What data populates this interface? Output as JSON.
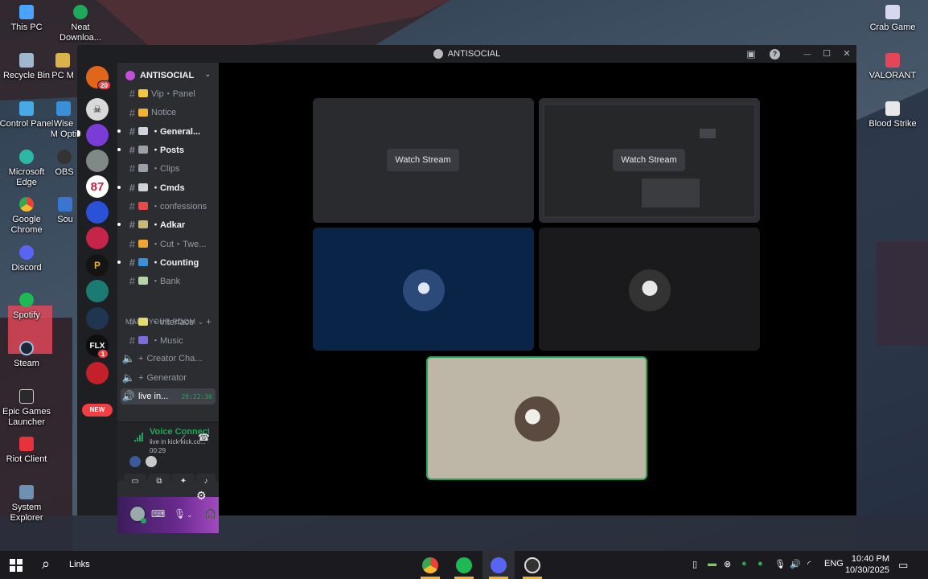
{
  "desktop": {
    "icons_left": [
      {
        "label": "This PC",
        "color": "#4aa3ff"
      },
      {
        "label": "Recycle Bin",
        "color": "#9fb7cf"
      },
      {
        "label": "Control Panel",
        "color": "#47a9e6"
      },
      {
        "label": "Microsoft Edge",
        "color": "#2fb7a6"
      },
      {
        "label": "Google Chrome",
        "color": "#e2b03a"
      },
      {
        "label": "Discord",
        "color": "#5865f2"
      },
      {
        "label": "Spotify",
        "color": "#1db954"
      },
      {
        "label": "Steam",
        "color": "#1b2838"
      },
      {
        "label": "Epic Games Launcher",
        "color": "#2a2a2a"
      },
      {
        "label": "Riot Client",
        "color": "#e6333b"
      },
      {
        "label": "System Explorer",
        "color": "#6f8fb3"
      }
    ],
    "icons_col2": [
      {
        "label": "Neat Downloa...",
        "color": "#1ea85c"
      },
      {
        "label": "PC M",
        "color": "#d9b24a"
      },
      {
        "label": "Wise M Opti",
        "color": "#3a8fd9"
      },
      {
        "label": "OBS",
        "color": "#333"
      },
      {
        "label": "Sou",
        "color": "#3a76d0"
      }
    ],
    "icons_right": [
      {
        "label": "Crab Game",
        "color": "#d7d7f0"
      },
      {
        "label": "VALORANT",
        "color": "#e34658"
      },
      {
        "label": "Blood Strike",
        "color": "#e8e8e8"
      }
    ]
  },
  "window": {
    "title": "ANTISOCIAL",
    "inbox_icon": "inbox-icon",
    "help_icon": "help-icon",
    "minimize": "—",
    "maximize": "☐",
    "close": "✕"
  },
  "guilds": {
    "items": [
      {
        "name": "guild-1",
        "color": "#e0661b",
        "badge": "20"
      },
      {
        "name": "guild-2",
        "color": "#d9d9d9"
      },
      {
        "name": "guild-3",
        "color": "#7a3bd6"
      },
      {
        "name": "guild-4",
        "color": "#7f8a86"
      },
      {
        "name": "guild-5",
        "color": "#ffffff",
        "text": "87"
      },
      {
        "name": "guild-6",
        "color": "#2a52d9"
      },
      {
        "name": "guild-7",
        "color": "#c7244a"
      },
      {
        "name": "guild-8",
        "color": "#141414",
        "text": "P"
      },
      {
        "name": "guild-9",
        "color": "#1b7b74"
      },
      {
        "name": "guild-10",
        "color": "#1f3550"
      },
      {
        "name": "guild-11",
        "color": "#0e0e0e",
        "text": "FLX",
        "badge": "1"
      },
      {
        "name": "guild-12",
        "color": "#c4202a"
      }
    ],
    "new_label": "NEW"
  },
  "server": {
    "name": "ANTISOCIAL",
    "channels": [
      {
        "label": "Vip・Panel",
        "emoji_color": "#f4c542",
        "unread": false
      },
      {
        "label": "Notice",
        "emoji_color": "#f2b233",
        "unread": false
      },
      {
        "label": "・General...",
        "emoji_color": "#cfd3da",
        "unread": true
      },
      {
        "label": "・Posts",
        "emoji_color": "#9aa0a8",
        "unread": true
      },
      {
        "label": "・Clips",
        "emoji_color": "#9aa0a8",
        "unread": false
      },
      {
        "label": "・Cmds",
        "emoji_color": "#cfd3da",
        "unread": true
      },
      {
        "label": "・confessions",
        "emoji_color": "#e84a4a",
        "unread": false
      },
      {
        "label": "・Adkar",
        "emoji_color": "#c9b87a",
        "unread": true
      },
      {
        "label": "・Cut・Twe...",
        "emoji_color": "#f0a531",
        "unread": false
      },
      {
        "label": "・Counting",
        "emoji_color": "#3d8fd9",
        "unread": true
      },
      {
        "label": "・Bank",
        "emoji_color": "#b7d6a7",
        "unread": false
      }
    ],
    "category": "MAKE YOUR ROOM",
    "room_channels": [
      {
        "label": "・interface",
        "type": "text"
      },
      {
        "label": "・Music",
        "type": "text"
      },
      {
        "label": "Creator Cha...",
        "type": "voice-plus"
      },
      {
        "label": "Generator",
        "type": "voice-plus"
      },
      {
        "label": "live in...",
        "type": "voice-live",
        "timer": "20:22:36"
      }
    ]
  },
  "voice": {
    "status": "Voice Connected",
    "channel": "live in kick kick.co...",
    "elapsed": "00:29"
  },
  "stream_tiles": {
    "watch_label_1": "Watch Stream",
    "watch_label_2": "Watch Stream"
  },
  "taskbar": {
    "search_label": "Links",
    "lang": "ENG",
    "time": "10:40 PM",
    "date": "10/30/2025"
  }
}
